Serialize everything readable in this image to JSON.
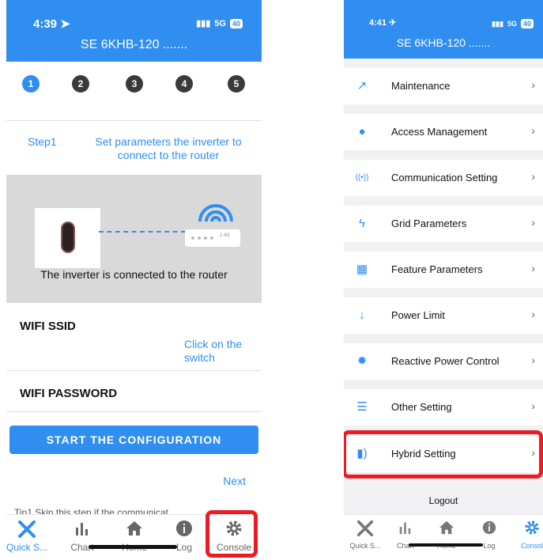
{
  "left_phone": {
    "status": {
      "time": "4:39",
      "signal": "5G",
      "battery": "40"
    },
    "title": "SE 6KHB-120 .......",
    "steps": [
      "1",
      "2",
      "3",
      "4",
      "5"
    ],
    "step_label": "Step1",
    "step_desc": "Set parameters the inverter to connect to the router",
    "router_text": "2.4G",
    "illustration_caption": "The inverter is connected to the router",
    "wifi_ssid_label": "WIFI SSID",
    "click_hint": "Click on the switch",
    "wifi_password_label": "WIFI PASSWORD",
    "start_button": "START THE CONFIGURATION",
    "next_link": "Next",
    "tip_text": "Tip1 Skip this step if the communicat",
    "tabs": [
      {
        "label": "Quick S...",
        "icon": "tools-icon"
      },
      {
        "label": "Chart",
        "icon": "chart-icon"
      },
      {
        "label": "Home",
        "icon": "home-icon"
      },
      {
        "label": "Log",
        "icon": "info-icon"
      },
      {
        "label": "Console",
        "icon": "gear-icon"
      }
    ]
  },
  "right_phone": {
    "status": {
      "time": "4:41",
      "signal": "5G",
      "battery": "40"
    },
    "title": "SE 6KHB-120 .......",
    "menu": [
      {
        "label": "Maintenance",
        "icon": "wrench-icon"
      },
      {
        "label": "Access Management",
        "icon": "user-icon"
      },
      {
        "label": "Communication Setting",
        "icon": "signal-icon"
      },
      {
        "label": "Grid Parameters",
        "icon": "lightning-icon"
      },
      {
        "label": "Feature Parameters",
        "icon": "grid-icon"
      },
      {
        "label": "Power Limit",
        "icon": "arrow-down-icon"
      },
      {
        "label": "Reactive Power Control",
        "icon": "gear-icon"
      },
      {
        "label": "Other Setting",
        "icon": "menu-icon"
      },
      {
        "label": "Hybrid Setting",
        "icon": "battery-icon"
      }
    ],
    "logout": "Logout",
    "tabs": [
      {
        "label": "Quick S...",
        "icon": "tools-icon"
      },
      {
        "label": "Chart",
        "icon": "chart-icon"
      },
      {
        "label": "Home",
        "icon": "home-icon"
      },
      {
        "label": "Log",
        "icon": "info-icon"
      },
      {
        "label": "Consol",
        "icon": "gear-icon"
      }
    ]
  },
  "colors": {
    "accent": "#2f8ef0",
    "highlight": "#ec1c24"
  }
}
